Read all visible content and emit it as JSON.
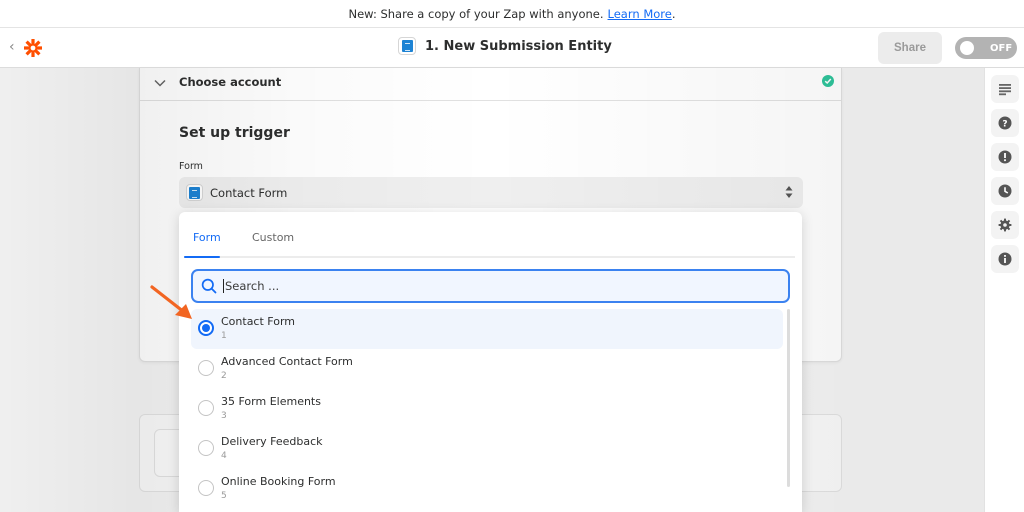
{
  "banner": {
    "text": "New: Share a copy of your Zap with anyone.",
    "link_label": "Learn More",
    "trailing": "."
  },
  "header": {
    "back_icon": "chevron-left-icon",
    "logo": "zapier-asterisk-logo",
    "title": "1. New Submission Entity",
    "share_label": "Share",
    "toggle_label": "OFF",
    "toggle_state": "off"
  },
  "rail": {
    "items": [
      {
        "name": "details-icon",
        "label": "Details"
      },
      {
        "name": "help-icon",
        "label": "Help"
      },
      {
        "name": "alert-icon",
        "label": "Alerts"
      },
      {
        "name": "history-icon",
        "label": "History"
      },
      {
        "name": "settings-icon",
        "label": "Settings"
      },
      {
        "name": "info-icon",
        "label": "Info"
      }
    ]
  },
  "step": {
    "accordion_title": "Choose account",
    "accordion_status": "complete",
    "setup_title": "Set up trigger",
    "field_label": "Form",
    "selected_value": "Contact Form"
  },
  "dropdown": {
    "tabs": [
      {
        "label": "Form",
        "active": true
      },
      {
        "label": "Custom",
        "active": false
      }
    ],
    "search_placeholder": "Search ...",
    "search_value": "",
    "options": [
      {
        "label": "Contact Form",
        "id": "1",
        "selected": true
      },
      {
        "label": "Advanced Contact Form",
        "id": "2",
        "selected": false
      },
      {
        "label": "35 Form Elements",
        "id": "3",
        "selected": false
      },
      {
        "label": "Delivery Feedback",
        "id": "4",
        "selected": false
      },
      {
        "label": "Online Booking Form",
        "id": "5",
        "selected": false
      }
    ]
  },
  "colors": {
    "accent": "#136bf5",
    "brand": "#ff4f00",
    "success": "#2fc49b",
    "annotation_arrow": "#f26522"
  }
}
